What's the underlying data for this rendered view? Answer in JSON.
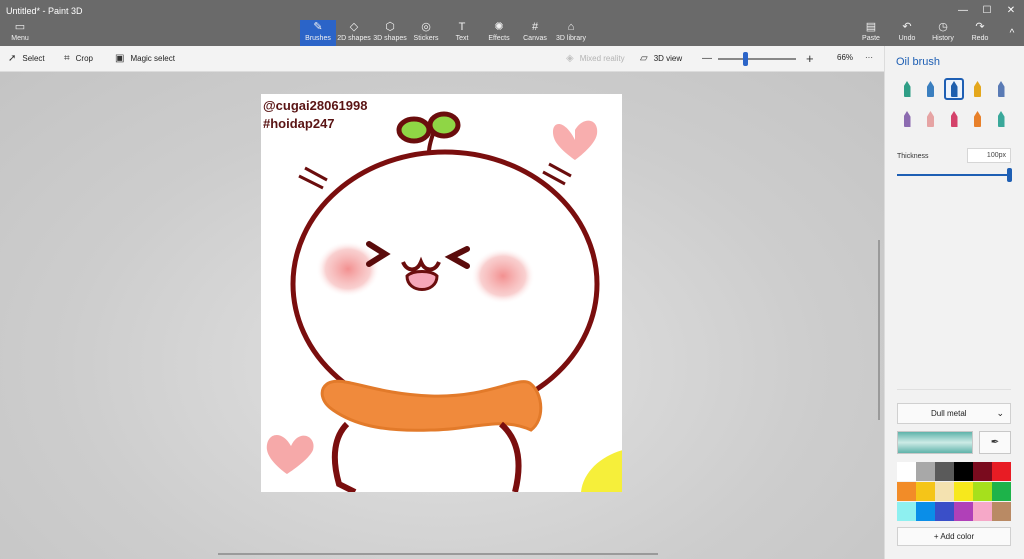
{
  "window": {
    "title": "Untitled* - Paint 3D"
  },
  "window_controls": {
    "minimize": "—",
    "maximize": "☐",
    "close": "✕",
    "collapse": "^"
  },
  "ribbon": {
    "menu": {
      "label": "Menu",
      "icon": "folder-icon",
      "glyph": "▭"
    },
    "tools": [
      {
        "label": "Brushes",
        "icon": "brush-icon",
        "glyph": "✎",
        "active": true
      },
      {
        "label": "2D shapes",
        "icon": "shapes-2d-icon",
        "glyph": "◇",
        "active": false
      },
      {
        "label": "3D shapes",
        "icon": "cube-icon",
        "glyph": "⬡",
        "active": false
      },
      {
        "label": "Stickers",
        "icon": "sticker-icon",
        "glyph": "◎",
        "active": false
      },
      {
        "label": "Text",
        "icon": "text-icon",
        "glyph": "T",
        "active": false
      },
      {
        "label": "Effects",
        "icon": "effects-sun-icon",
        "glyph": "✺",
        "active": false
      },
      {
        "label": "Canvas",
        "icon": "canvas-crop-icon",
        "glyph": "#",
        "active": false
      },
      {
        "label": "3D library",
        "icon": "3d-library-icon",
        "glyph": "⌂",
        "active": false
      }
    ],
    "actions": [
      {
        "label": "Paste",
        "icon": "paste-clipboard-icon",
        "glyph": "▤"
      },
      {
        "label": "Undo",
        "icon": "undo-icon",
        "glyph": "↶"
      },
      {
        "label": "History",
        "icon": "history-clock-icon",
        "glyph": "◷"
      },
      {
        "label": "Redo",
        "icon": "redo-icon",
        "glyph": "↷"
      }
    ]
  },
  "toolbar": {
    "select": "Select",
    "crop": "Crop",
    "magic_select": "Magic select",
    "mixed_reality": "Mixed reality",
    "view_3d": "3D view",
    "zoom_out": "—",
    "zoom_in": "+",
    "zoom_percent": "66%",
    "more": "···"
  },
  "canvas": {
    "watermark_1": "@cugai28061998",
    "watermark_2": "#hoidap247"
  },
  "panel": {
    "title": "Oil brush",
    "brushes": [
      {
        "name": "marker",
        "color": "#2f9e86",
        "selected": false
      },
      {
        "name": "calligraphy-pen",
        "color": "#3b7fbf",
        "selected": false
      },
      {
        "name": "oil-brush",
        "color": "#1f5fae",
        "selected": true
      },
      {
        "name": "watercolor",
        "color": "#e4a71c",
        "selected": false
      },
      {
        "name": "pixel-pen",
        "color": "#5a7bb5",
        "selected": false
      },
      {
        "name": "pencil",
        "color": "#8c6bb0",
        "selected": false
      },
      {
        "name": "eraser",
        "color": "#e6a4a4",
        "selected": false
      },
      {
        "name": "crayon",
        "color": "#d4426a",
        "selected": false
      },
      {
        "name": "spray-can",
        "color": "#e8802a",
        "selected": false
      },
      {
        "name": "fill",
        "color": "#3aa89a",
        "selected": false
      }
    ],
    "thickness_label": "Thickness",
    "thickness_value": "100px",
    "thickness_level": 1.0,
    "material": "Dull metal",
    "selected_color": "#5fb3aa",
    "palette": [
      "#ffffff",
      "#a8a8a8",
      "#5a5a5a",
      "#000000",
      "#7a0b1e",
      "#e81c24",
      "#f28c28",
      "#f5c518",
      "#f4e2b0",
      "#f7e81c",
      "#a6e01c",
      "#1db34a",
      "#8ef0f0",
      "#0a8ee8",
      "#3a4fc8",
      "#b040b8",
      "#f6a8c8",
      "#b98a64"
    ],
    "add_color": "Add color"
  }
}
